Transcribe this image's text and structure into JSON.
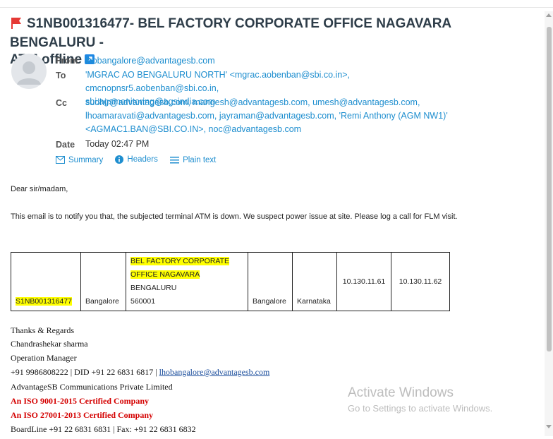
{
  "email": {
    "subject_line1": "S1NB001316477- BEL FACTORY CORPORATE OFFICE NAGAVARA BENGALURU -",
    "subject_line2": "ATM offline",
    "from_label": "From",
    "from_value": "lhobangalore@advantagesb.com",
    "to_label": "To",
    "to_value_line1": "'MGRAC AO BENGALURU NORTH' <mgrac.aobenban@sbi.co.in>, cmcnopnsr5.aobenban@sbi.co.in,",
    "to_value_line2": "sbi.agsmonitoring@agsindia.com",
    "cc_label": "Cc",
    "cc_value_line1": "sudhir@advantagesb.com, mangesh@advantagesb.com, umesh@advantagesb.com,",
    "cc_value_line2": "lhoamaravati@advantagesb.com, jayraman@advantagesb.com, 'Remi Anthony (AGM NW1)'",
    "cc_value_line3": "<AGMAC1.BAN@SBI.CO.IN>, noc@advantagesb.com",
    "date_label": "Date",
    "date_value": "Today 02:47 PM",
    "links": {
      "summary": "Summary",
      "headers": "Headers",
      "plain": "Plain text"
    }
  },
  "body": {
    "greeting": "Dear sir/madam,",
    "message": "This email is to notify you that, the subjected terminal ATM is down. We suspect power issue at site. Please log a call for FLM visit."
  },
  "atm_table": {
    "terminal_id": "S1NB001316477",
    "city": "Bangalore",
    "address_hl_line1": "BEL FACTORY CORPORATE",
    "address_hl_line2": "OFFICE NAGAVARA",
    "address_rest": " BENGALURU",
    "address_line3": "560001",
    "region": "Bangalore",
    "state": "Karnataka",
    "ip1": "10.130.11.61",
    "ip2": "10.130.11.62"
  },
  "signature": {
    "thanks": "Thanks & Regards",
    "name": "Chandrashekar sharma",
    "title": "Operation Manager",
    "phone": "+91 9986808222 | DID +91 22 6831 6817 | ",
    "email": "lhobangalore@advantagesb.com",
    "company": "AdvantageSB Communications Private Limited",
    "iso1": "An ISO 9001-2015 Certified Company",
    "iso2": "An ISO 27001-2013 Certified Company",
    "boardline": "BoardLine +91 22 6831 6831 | Fax: +91 22 6831 6832"
  },
  "watermark": {
    "title": "Activate Windows",
    "subtitle": "Go to Settings to activate Windows."
  },
  "colors": {
    "link": "#1e8ecf",
    "flag": "#e53935",
    "highlight": "#ffff00",
    "iso_red": "#d40000"
  }
}
